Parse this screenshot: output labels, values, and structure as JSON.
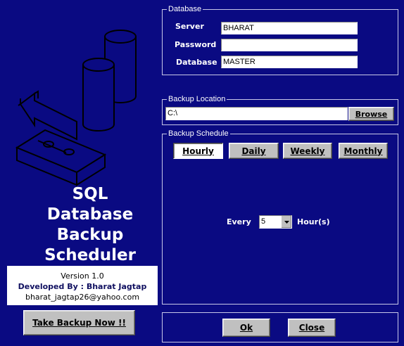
{
  "app": {
    "title_lines": [
      "SQL",
      "Database",
      "Backup",
      "Scheduler"
    ],
    "version": "Version 1.0",
    "developer": "Developed By : Bharat Jagtap",
    "email": "bharat_jagtap26@yahoo.com",
    "take_backup_label": "Take Backup Now !!"
  },
  "database": {
    "legend": "Database",
    "server_label": "Server",
    "server_value": "BHARAT",
    "password_label": "Password",
    "password_value": "",
    "database_label": "Database",
    "database_value": "MASTER"
  },
  "backup_location": {
    "legend": "Backup Location",
    "path_value": "C:\\",
    "browse_label": "Browse"
  },
  "schedule": {
    "legend": "Backup Schedule",
    "tabs": [
      "Hourly",
      "Daily",
      "Weekly",
      "Monthly"
    ],
    "selected_tab": "Hourly",
    "every_label": "Every",
    "interval_value": "5",
    "unit_label": "Hour(s)"
  },
  "actions": {
    "ok_label": "Ok",
    "close_label": "Close"
  },
  "colors": {
    "background": "#0a0a82",
    "button_face": "#c0c0c0",
    "text_light": "#ffffff"
  },
  "icons": [
    "database-cylinder-icon",
    "backup-arrow-icon"
  ]
}
